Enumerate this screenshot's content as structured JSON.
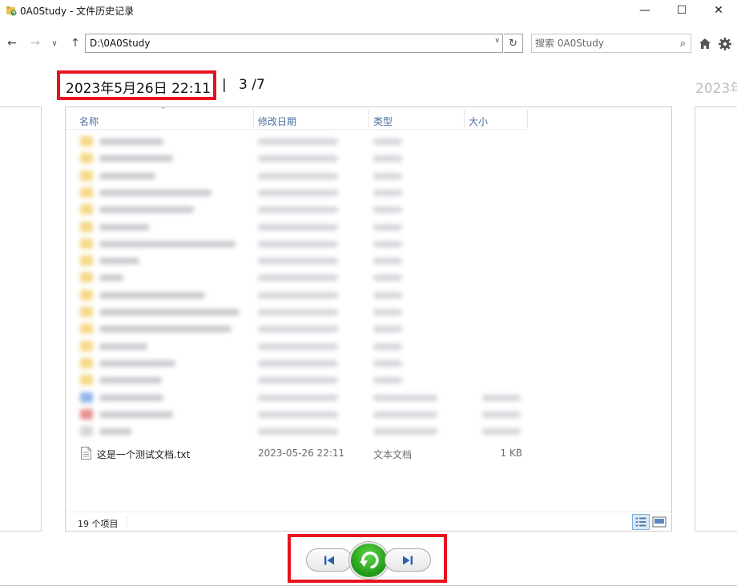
{
  "window": {
    "title": "0A0Study - 文件历史记录",
    "minimize_glyph": "—",
    "maximize_glyph": "☐",
    "close_glyph": "✕"
  },
  "nav": {
    "back_glyph": "←",
    "forward_glyph": "→",
    "history_glyph": "∨",
    "up_glyph": "↑",
    "address": "D:\\0A0Study",
    "address_dropdown_glyph": "∨",
    "refresh_glyph": "↻",
    "search_placeholder": "搜索 0A0Study",
    "search_glyph": "⌕"
  },
  "snapshot": {
    "date": "2023年5月26日 22:11",
    "separator": "|",
    "position": "3 /7",
    "next_date": "2023年"
  },
  "columns": {
    "name": "名称",
    "modified": "修改日期",
    "type": "类型",
    "size": "大小",
    "sort_glyph": "^"
  },
  "blurred_rows": [
    {
      "kind": "folder",
      "name_len": 80
    },
    {
      "kind": "folder",
      "name_len": 92
    },
    {
      "kind": "folder",
      "name_len": 70
    },
    {
      "kind": "folder",
      "name_len": 140
    },
    {
      "kind": "folder",
      "name_len": 118
    },
    {
      "kind": "folder",
      "name_len": 62
    },
    {
      "kind": "folder",
      "name_len": 170
    },
    {
      "kind": "folder",
      "name_len": 50
    },
    {
      "kind": "folder",
      "name_len": 30
    },
    {
      "kind": "folder",
      "name_len": 132
    },
    {
      "kind": "folder",
      "name_len": 175
    },
    {
      "kind": "folder",
      "name_len": 165
    },
    {
      "kind": "folder",
      "name_len": 60
    },
    {
      "kind": "folder",
      "name_len": 95
    },
    {
      "kind": "folder",
      "name_len": 78
    },
    {
      "kind": "file-blue",
      "name_len": 80
    },
    {
      "kind": "file-red",
      "name_len": 92
    },
    {
      "kind": "file",
      "name_len": 40
    }
  ],
  "file": {
    "name": "这是一个测试文档.txt",
    "modified": "2023-05-26 22:11",
    "type": "文本文档",
    "size": "1 KB"
  },
  "status": {
    "count": "19 个项目"
  },
  "colors": {
    "highlight": "#e8131f",
    "restore_green": "#2db320",
    "folder": "#f5d888",
    "column_header": "#4a6fa5"
  }
}
